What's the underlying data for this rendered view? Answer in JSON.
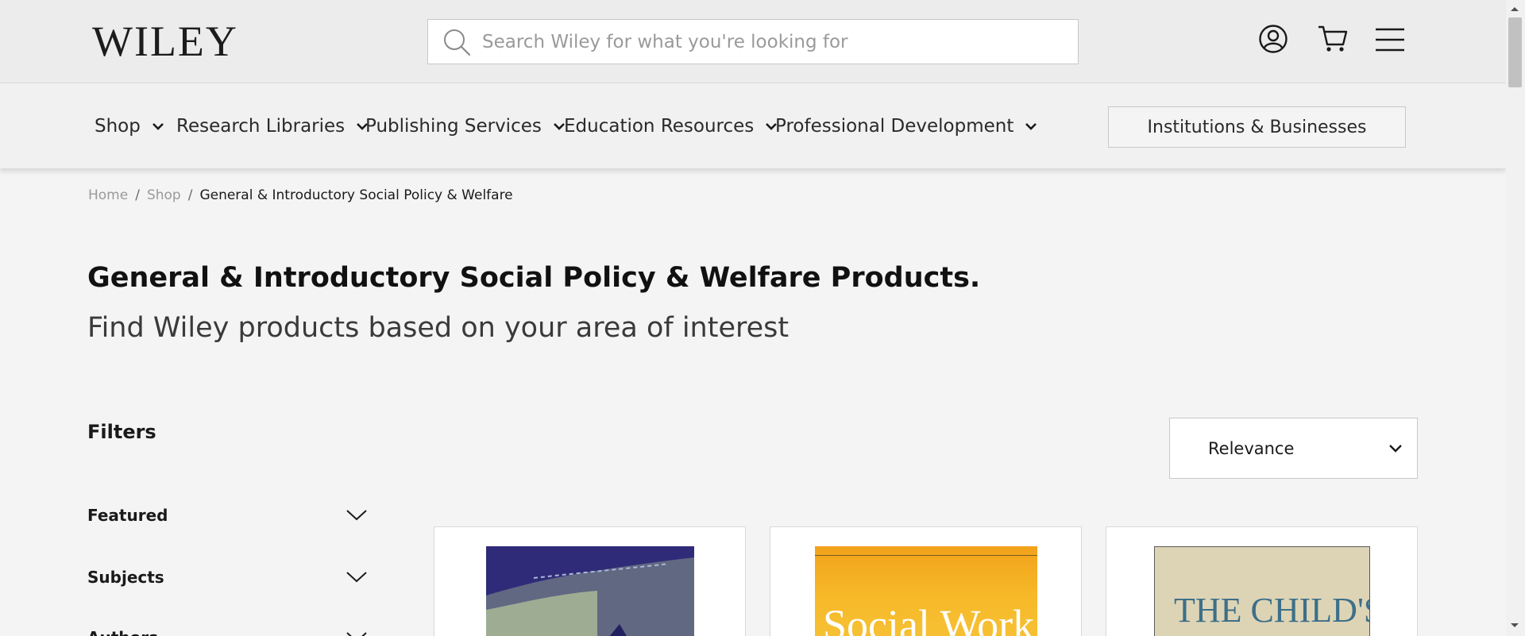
{
  "header": {
    "logo": "WILEY",
    "search_placeholder": "Search Wiley for what you're looking for",
    "icons": [
      "search-icon",
      "account-icon",
      "cart-icon",
      "menu-icon"
    ]
  },
  "nav": {
    "items": [
      {
        "label": "Shop"
      },
      {
        "label": "Research Libraries"
      },
      {
        "label": "Publishing Services"
      },
      {
        "label": "Education Resources"
      },
      {
        "label": "Professional Development"
      }
    ],
    "institutions_button": "Institutions & Businesses"
  },
  "breadcrumb": {
    "home": "Home",
    "shop": "Shop",
    "current": "General & Introductory Social Policy & Welfare",
    "separator": "/"
  },
  "page": {
    "title": "General & Introductory Social Policy & Welfare Products.",
    "subtitle": "Find Wiley products based on your area of interest"
  },
  "filters": {
    "heading": "Filters",
    "groups": [
      "Featured",
      "Subjects",
      "Authors"
    ]
  },
  "sort": {
    "selected": "Relevance"
  },
  "products": [
    {
      "cover_text": ""
    },
    {
      "cover_text": "Social Work"
    },
    {
      "cover_text": "THE CHILD'S"
    }
  ],
  "colors": {
    "page_background": "#f4f4f4",
    "header_background": "#ececec",
    "cover_blue": "#2f2b78",
    "cover_yellow": "#f6b928",
    "cover_beige": "#ddd4b6",
    "cover_teal_text": "#3d6f88"
  }
}
